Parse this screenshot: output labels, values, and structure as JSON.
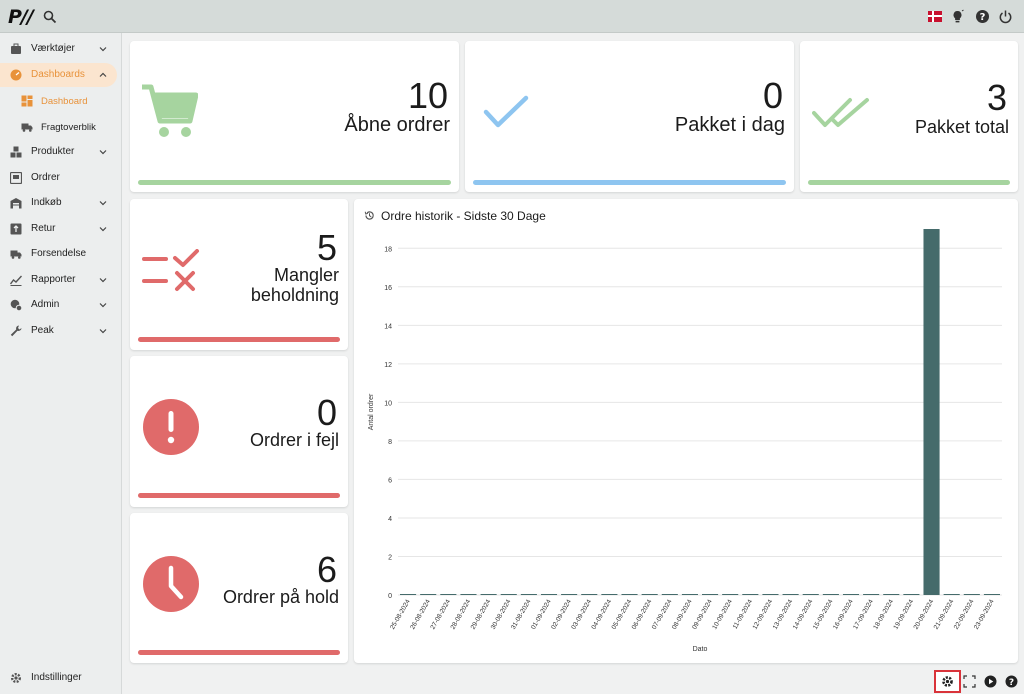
{
  "topbar": {
    "logo": "P//",
    "icons": [
      "search-icon",
      "flag-denmark-icon",
      "lightbulb-icon",
      "help-icon",
      "power-icon"
    ]
  },
  "sidebar": {
    "items": [
      {
        "label": "Værktøjer",
        "icon": "toolbox-icon",
        "has_chevron": true
      },
      {
        "label": "Dashboards",
        "icon": "dashboard-gauge-icon",
        "has_chevron": true,
        "active": true
      },
      {
        "label": "Dashboard",
        "icon": "grid-icon",
        "sub": true,
        "active": true
      },
      {
        "label": "Fragtoverblik",
        "icon": "truck-icon",
        "sub": true
      },
      {
        "label": "Produkter",
        "icon": "boxes-icon",
        "has_chevron": true
      },
      {
        "label": "Ordrer",
        "icon": "inbox-icon"
      },
      {
        "label": "Indkøb",
        "icon": "warehouse-icon",
        "has_chevron": true
      },
      {
        "label": "Retur",
        "icon": "return-box-icon",
        "has_chevron": true
      },
      {
        "label": "Forsendelse",
        "icon": "truck-icon"
      },
      {
        "label": "Rapporter",
        "icon": "report-chart-icon",
        "has_chevron": true
      },
      {
        "label": "Admin",
        "icon": "admin-gear-icon",
        "has_chevron": true
      },
      {
        "label": "Peak",
        "icon": "wrench-icon",
        "has_chevron": true
      }
    ],
    "footer_label": "Indstillinger",
    "accent_color": "#e8923a"
  },
  "kpis": {
    "open_orders": {
      "value": "10",
      "label": "Åbne ordrer",
      "color": "#a6d49f",
      "icon": "cart-icon"
    },
    "packed_today": {
      "value": "0",
      "label": "Pakket i dag",
      "color": "#8ec5f0",
      "icon": "check-icon"
    },
    "packed_total": {
      "value": "3",
      "label": "Pakket total",
      "color": "#a6d49f",
      "icon": "double-check-icon"
    },
    "missing_stock": {
      "value": "5",
      "label_line1": "Mangler",
      "label_line2": "beholdning",
      "color": "#e06a6a",
      "icon": "check-cross-list-icon"
    },
    "error_orders": {
      "value": "0",
      "label": "Ordrer i fejl",
      "color": "#e06a6a",
      "icon": "alert-circle-icon"
    },
    "on_hold": {
      "value": "6",
      "label": "Ordrer på hold",
      "color": "#e06a6a",
      "icon": "clock-icon"
    }
  },
  "chart_panel": {
    "title": "Ordre historik - Sidste 30 Dage",
    "icon": "history-icon"
  },
  "chart_data": {
    "type": "bar",
    "title": "Ordre historik - Sidste 30 Dage",
    "xlabel": "Dato",
    "ylabel": "Antal ordrer",
    "ylim": [
      0,
      19
    ],
    "yticks": [
      0,
      2,
      4,
      6,
      8,
      10,
      12,
      14,
      16,
      18
    ],
    "grid": true,
    "bar_color": "#456b6b",
    "categories": [
      "25-08-2024",
      "26-08-2024",
      "27-08-2024",
      "28-08-2024",
      "29-08-2024",
      "30-08-2024",
      "31-08-2024",
      "01-09-2024",
      "02-09-2024",
      "03-09-2024",
      "04-09-2024",
      "05-09-2024",
      "06-09-2024",
      "07-09-2024",
      "08-09-2024",
      "09-09-2024",
      "10-09-2024",
      "11-09-2024",
      "12-09-2024",
      "13-09-2024",
      "14-09-2024",
      "15-09-2024",
      "16-09-2024",
      "17-09-2024",
      "18-09-2024",
      "19-09-2024",
      "20-09-2024",
      "21-09-2024",
      "22-09-2024",
      "23-09-2024"
    ],
    "values": [
      0,
      0,
      0,
      0,
      0,
      0,
      0,
      0,
      0,
      0,
      0,
      0,
      0,
      0,
      0,
      0,
      0,
      0,
      0,
      0,
      0,
      0,
      0,
      0,
      0,
      0,
      19,
      0,
      0,
      0
    ]
  },
  "bottom_toolbar": {
    "icons": [
      "settings-icon",
      "fullscreen-icon",
      "play-icon",
      "help-icon"
    ]
  }
}
